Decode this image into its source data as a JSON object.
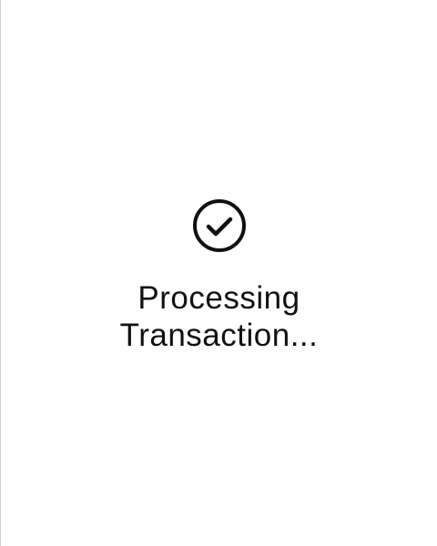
{
  "status": {
    "icon": "check-circle-icon",
    "line1": "Processing",
    "line2": "Transaction..."
  },
  "colors": {
    "background": "#ffffff",
    "text": "#111111",
    "icon": "#111111",
    "left_border": "#cfcfcf"
  }
}
